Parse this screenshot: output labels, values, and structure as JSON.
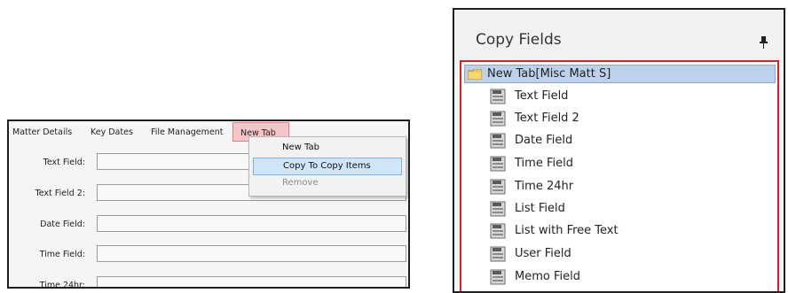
{
  "left_panel": {
    "tabs": [
      "Matter Details",
      "Key Dates",
      "File Management",
      "New Tab"
    ],
    "fields": [
      {
        "label": "Text Field:",
        "value": ""
      },
      {
        "label": "Text Field 2:",
        "value": ""
      },
      {
        "label": "Date Field:",
        "value": ""
      },
      {
        "label": "Time Field:",
        "value": ""
      },
      {
        "label": "Time 24hr:",
        "value": ""
      }
    ],
    "context_menu": {
      "items": [
        "New Tab",
        "Copy To Copy Items",
        "Remove"
      ]
    }
  },
  "right_panel": {
    "title": "Copy Fields",
    "tree": {
      "root": "New Tab[Misc Matt S]",
      "items": [
        "Text Field",
        "Text Field 2",
        "Date Field",
        "Time Field",
        "Time 24hr",
        "List Field",
        "List with Free Text",
        "User Field",
        "Memo Field"
      ]
    }
  },
  "colors": {
    "tab_highlight": "#f4c6c9",
    "menu_highlight": "#cfe6fb",
    "tree_border": "#e31d24",
    "tree_selected": "#bcd2ec"
  }
}
